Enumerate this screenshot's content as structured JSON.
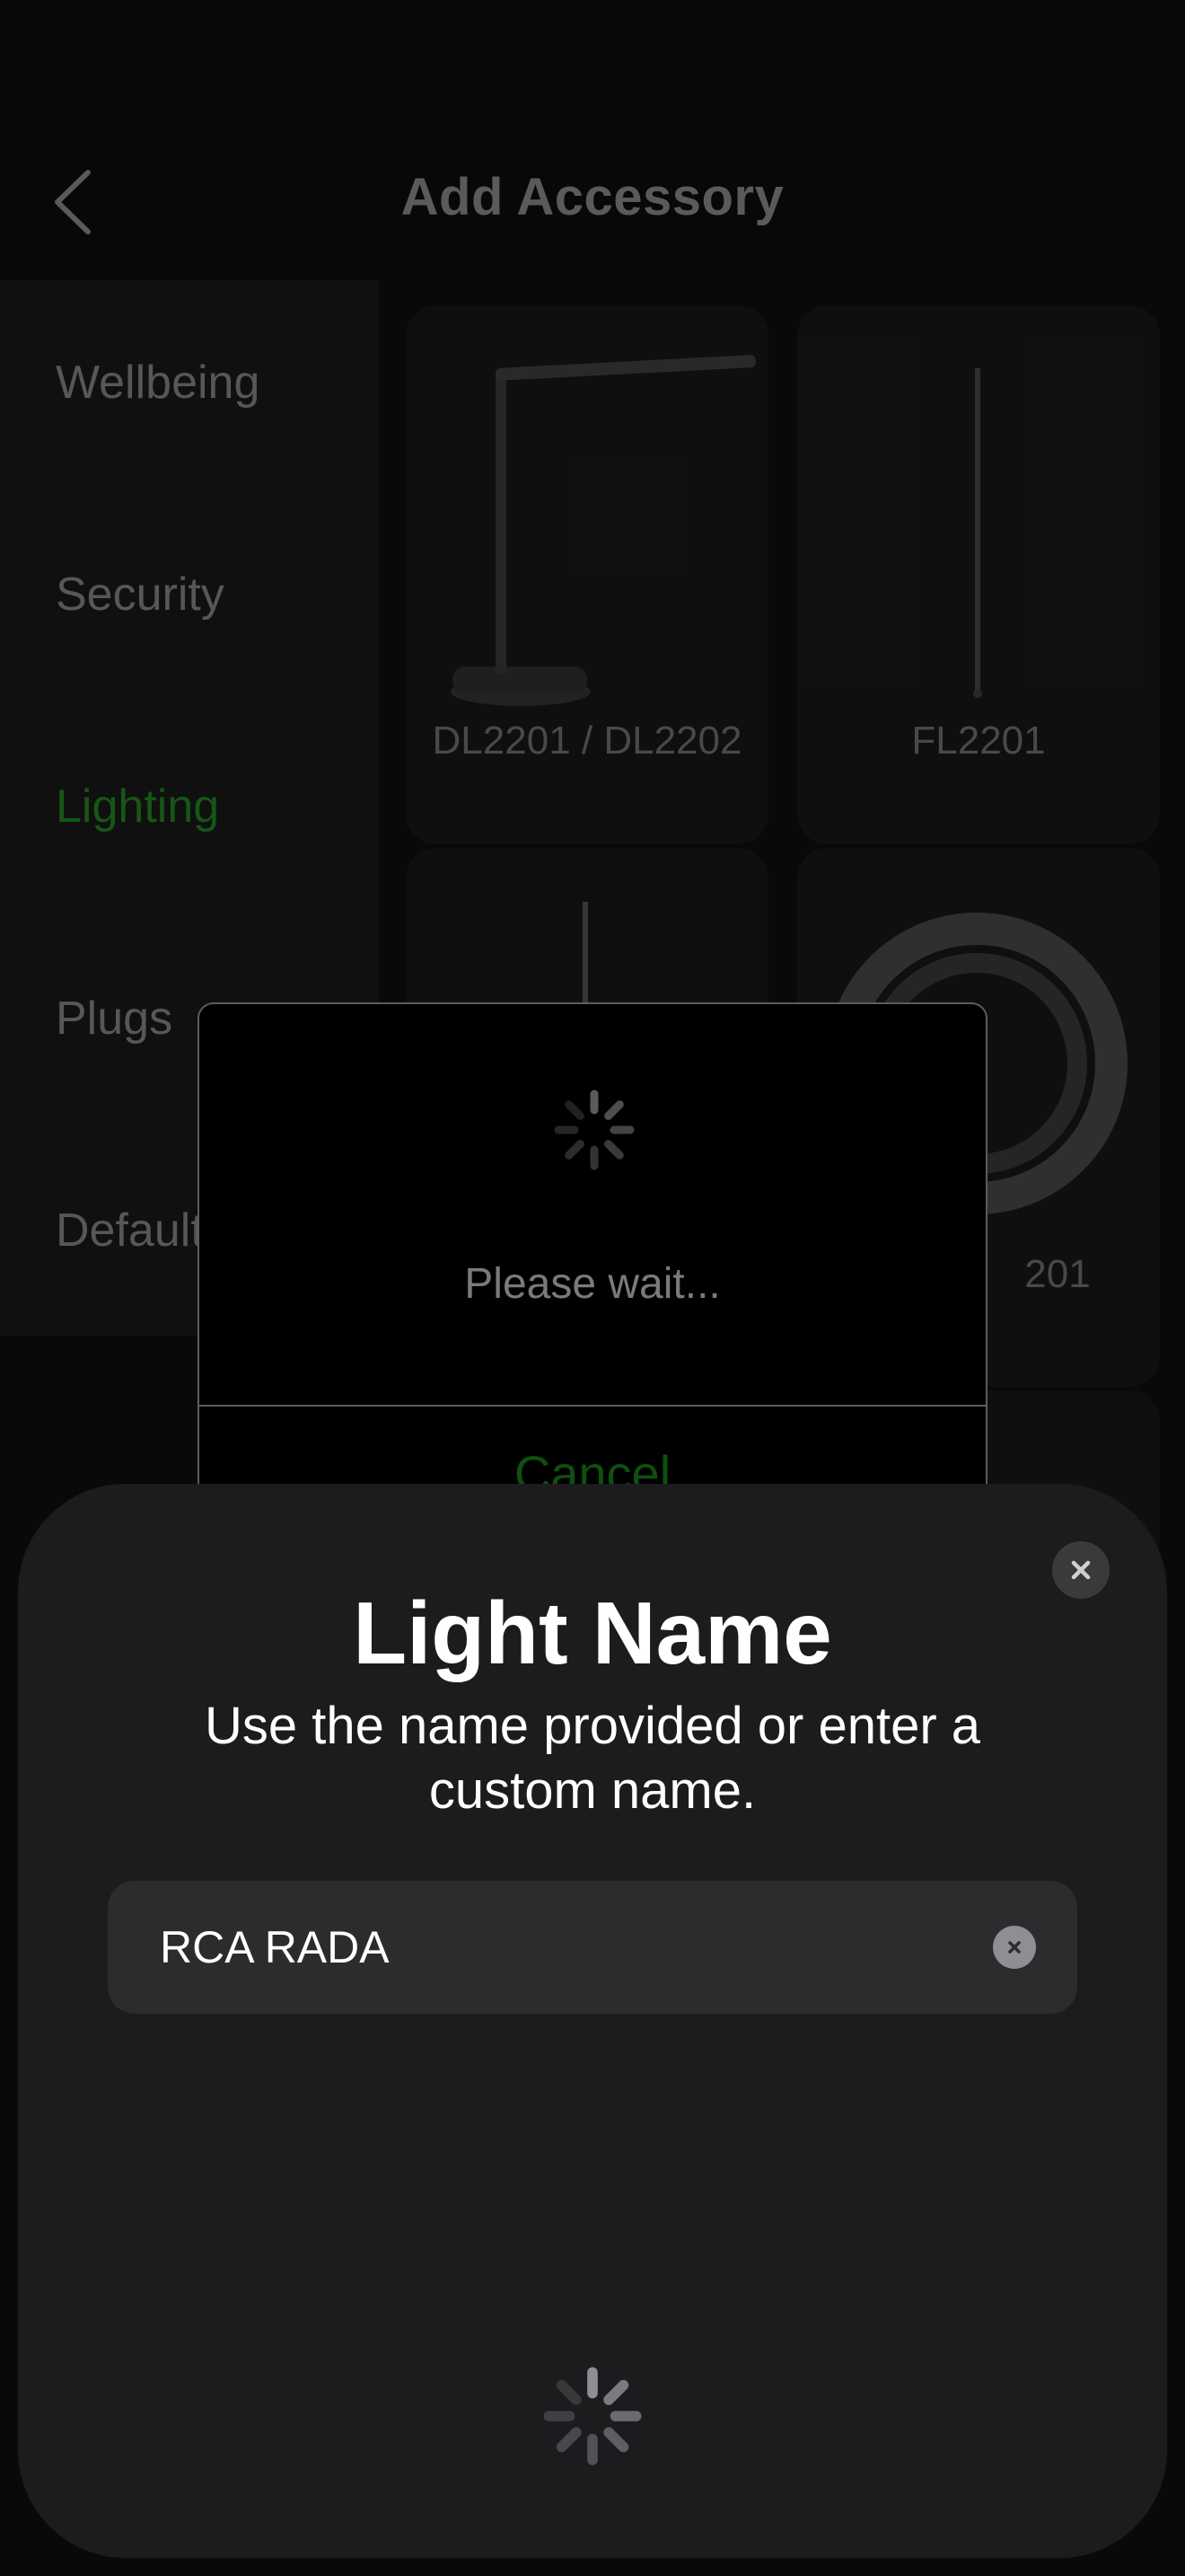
{
  "header": {
    "title": "Add Accessory",
    "back_icon": "chevron-left-icon"
  },
  "sidebar": {
    "items": [
      {
        "label": "Wellbeing",
        "active": false
      },
      {
        "label": "Security",
        "active": false
      },
      {
        "label": "Lighting",
        "active": true
      },
      {
        "label": "Plugs",
        "active": false
      },
      {
        "label": "Default",
        "active": false
      }
    ]
  },
  "products": [
    {
      "label": "DL2201 / DL2202",
      "image": "desk-lamp"
    },
    {
      "label": "FL2201",
      "image": "floor-lamp"
    },
    {
      "label": "",
      "image": "floor-lamp"
    },
    {
      "label": "201",
      "image": "light-strip-coil"
    }
  ],
  "dialog": {
    "message": "Please wait...",
    "cancel_label": "Cancel",
    "spinner_icon": "spinner-icon"
  },
  "sheet": {
    "title": "Light Name",
    "subtitle": "Use the name provided or enter a custom name.",
    "name_value": "RCA RADA",
    "close_icon": "close-icon",
    "clear_icon": "clear-icon",
    "spinner_icon": "spinner-icon"
  },
  "colors": {
    "accent_green": "#1c6a1c",
    "sheet_bg": "#1c1c1e",
    "field_bg": "#2c2c2e"
  }
}
